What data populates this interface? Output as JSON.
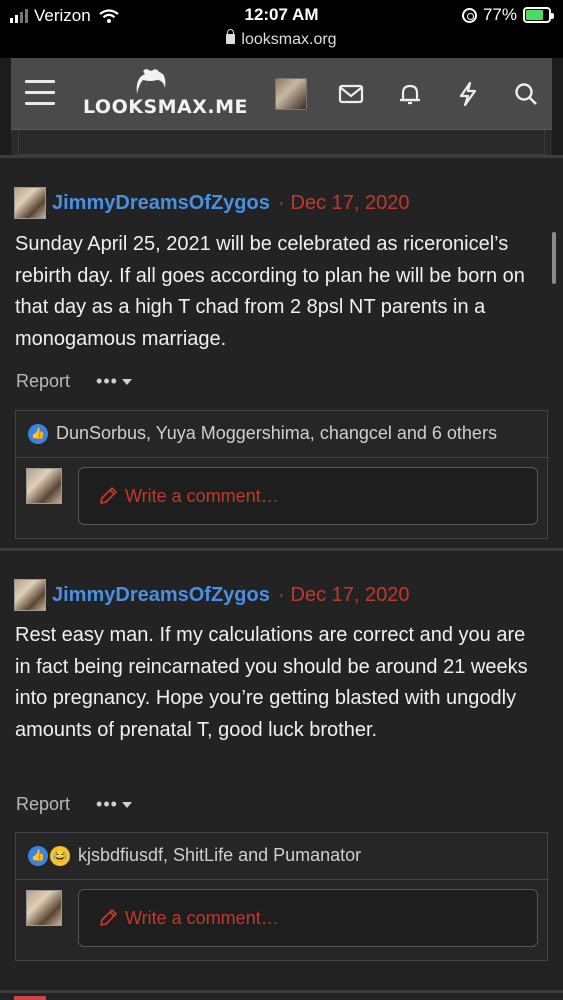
{
  "status_bar": {
    "carrier": "Verizon",
    "time": "12:07 AM",
    "url": "looksmax.org",
    "battery": "77%",
    "battery_level": 0.77
  },
  "header": {
    "logo_text": "LOOKSMAX.ME",
    "icons": [
      "menu-icon",
      "envelope-icon",
      "bell-icon",
      "bolt-icon",
      "search-icon"
    ]
  },
  "posts": [
    {
      "author": "JimmyDreamsOfZygos",
      "separator": "·",
      "date": "Dec 17, 2020",
      "body": "Sunday April 25, 2021 will be celebrated as riceronicel’s rebirth day. If all goes according to plan he will be born on that day as a high T chad from 2 8psl NT parents in a monogamous marriage.",
      "report": "Report",
      "more": "•••",
      "reactions": "DunSorbus, Yuya Moggershima, changcel and 6 others",
      "comment_placeholder": "Write a comment…"
    },
    {
      "author": "JimmyDreamsOfZygos",
      "separator": "·",
      "date": "Dec 17, 2020",
      "body": "Rest easy man. If my calculations are correct and you are in fact being reincarnated you should be around 21 weeks into pregnancy. Hope you’re getting blasted with ungodly amounts of prenatal T, good luck brother.",
      "report": "Report",
      "more": "•••",
      "reactions": "kjsbdfiusdf, ShitLife and Pumanator",
      "comment_placeholder": "Write a comment…"
    }
  ],
  "colors": {
    "username": "#4a90e2",
    "date": "#c0392b",
    "like": "#3b83e0"
  }
}
